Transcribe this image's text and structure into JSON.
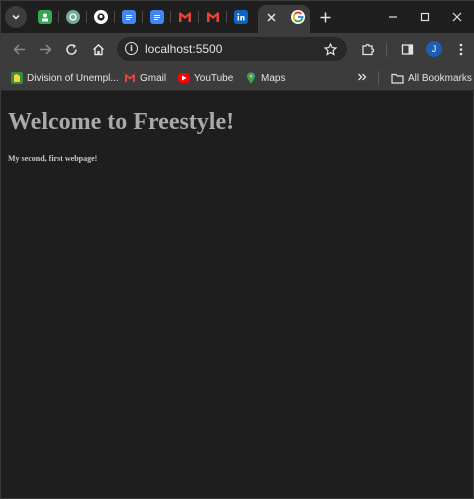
{
  "browser": {
    "tabs": [
      {
        "icon": "profile-favicon-icon",
        "color": "#34a853"
      },
      {
        "icon": "chatgpt-favicon-icon",
        "color": "#74aa9c"
      },
      {
        "icon": "github-favicon-icon",
        "color": "#ffffff"
      },
      {
        "icon": "google-docs-favicon-icon",
        "color": "#4285f4"
      },
      {
        "icon": "google-docs-favicon-icon",
        "color": "#4285f4"
      },
      {
        "icon": "gmail-favicon-icon",
        "color": "#ea4335"
      },
      {
        "icon": "gmail-favicon-icon",
        "color": "#ea4335"
      },
      {
        "icon": "linkedin-favicon-icon",
        "color": "#0a66c2"
      },
      {
        "icon": "google-favicon-icon",
        "color": "#ffffff"
      }
    ],
    "address_bar": {
      "url": "localhost:5500"
    },
    "profile_initial": "J",
    "bookmarks": [
      {
        "label": "Division of Unempl...",
        "icon": "unemployment-favicon-icon",
        "color": "#3c8a3c"
      },
      {
        "label": "Gmail",
        "icon": "gmail-favicon-icon",
        "color": "#ea4335"
      },
      {
        "label": "YouTube",
        "icon": "youtube-favicon-icon",
        "color": "#ff0000"
      },
      {
        "label": "Maps",
        "icon": "maps-favicon-icon",
        "color": "#34a853"
      }
    ],
    "all_bookmarks_label": "All Bookmarks"
  },
  "page": {
    "title": "Welcome to Freestyle!",
    "subtitle": "My second, first webpage!"
  },
  "colors": {
    "frame": "#1f1f1f",
    "toolbar": "#3c3c3c",
    "page_background": "#1e1e1e",
    "title_text": "#a9a9a9"
  }
}
